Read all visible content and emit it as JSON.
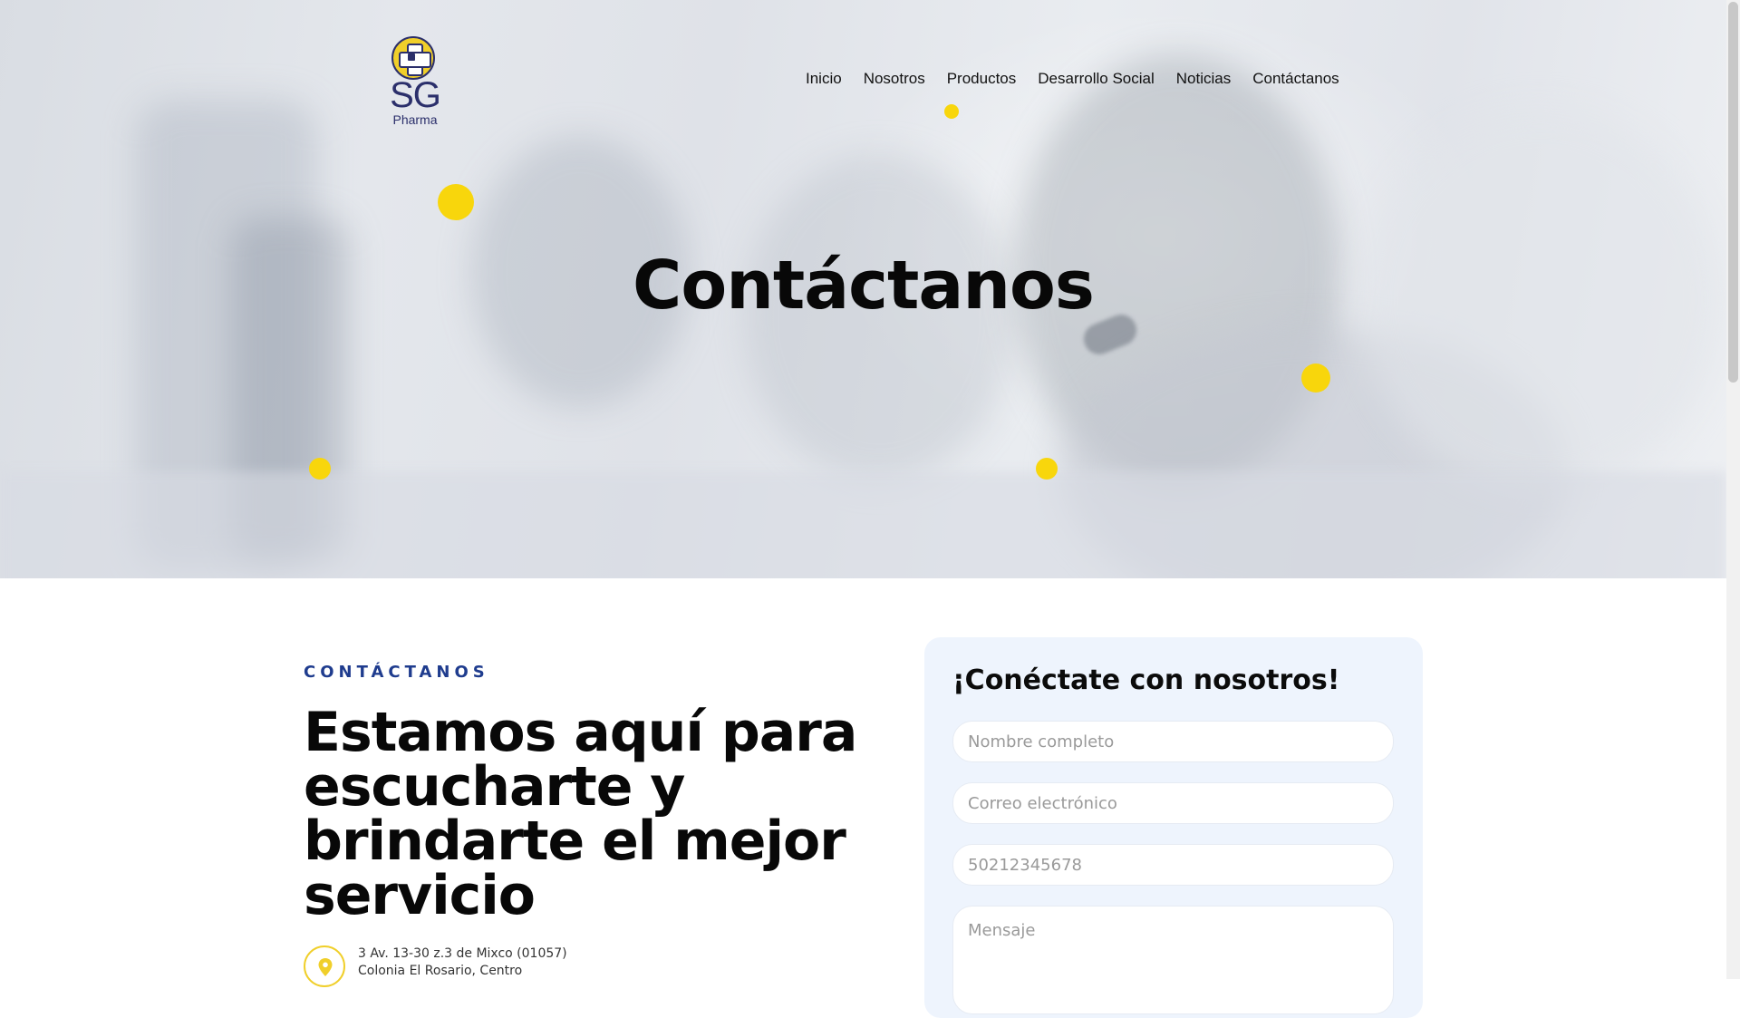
{
  "brand": {
    "sg": "SG",
    "pharma": "Pharma",
    "accent_color": "#f8d60c",
    "brand_color": "#2b2f6b"
  },
  "nav": {
    "items": [
      "Inicio",
      "Nosotros",
      "Productos",
      "Desarrollo Social",
      "Noticias",
      "Contáctanos"
    ]
  },
  "hero": {
    "title": "Contáctanos"
  },
  "contact": {
    "eyebrow": "CONTÁCTANOS",
    "headline": "Estamos aquí para escucharte y brindarte el mejor servicio",
    "address_line1": "3 Av. 13-30 z.3 de Mixco (01057)",
    "address_line2": "Colonia El Rosario, Centro"
  },
  "form": {
    "title": "¡Conéctate con nosotros!",
    "name_placeholder": "Nombre completo",
    "email_placeholder": "Correo electrónico",
    "phone_placeholder": "50212345678",
    "message_placeholder": "Mensaje"
  }
}
